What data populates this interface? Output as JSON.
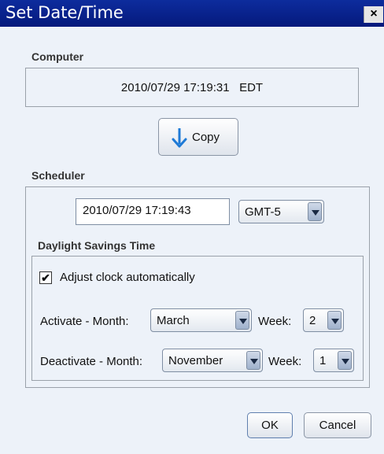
{
  "window": {
    "title": "Set Date/Time",
    "close_glyph": "×"
  },
  "computer": {
    "label": "Computer",
    "datetime": "2010/07/29 17:19:31",
    "timezone": "EDT"
  },
  "copy_button": {
    "label": "Copy",
    "icon": "down-arrow-icon"
  },
  "scheduler": {
    "label": "Scheduler",
    "datetime_value": "2010/07/29 17:19:43",
    "timezone_selected": "GMT-5"
  },
  "dst": {
    "label": "Daylight Savings Time",
    "adjust_label": "Adjust clock automatically",
    "adjust_checked": true,
    "check_glyph": "✔",
    "activate_label": "Activate  -  Month:",
    "activate_month": "March",
    "activate_week_label": "Week:",
    "activate_week": "2",
    "deactivate_label": "Deactivate - Month:",
    "deactivate_month": "November",
    "deactivate_week_label": "Week:",
    "deactivate_week": "1"
  },
  "buttons": {
    "ok": "OK",
    "cancel": "Cancel"
  }
}
